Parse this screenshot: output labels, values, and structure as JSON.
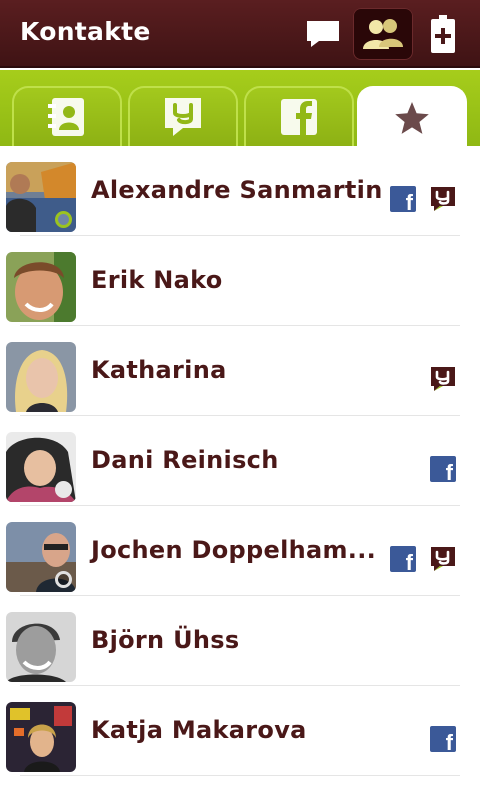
{
  "header": {
    "title": "Kontakte",
    "icons": [
      "message-icon",
      "contacts-icon",
      "battery-icon"
    ]
  },
  "tabs": [
    {
      "name": "address-book",
      "icon": "address-book-icon",
      "selected": false
    },
    {
      "name": "yap",
      "icon": "yap-icon",
      "selected": false
    },
    {
      "name": "facebook",
      "icon": "facebook-icon",
      "selected": false
    },
    {
      "name": "favorites",
      "icon": "star-icon",
      "selected": true
    }
  ],
  "contacts": [
    {
      "name": "Alexandre Sanmartin",
      "status": "online",
      "badges": [
        "facebook",
        "yap"
      ]
    },
    {
      "name": "Erik Nako",
      "status": "none",
      "badges": []
    },
    {
      "name": "Katharina",
      "status": "none",
      "badges": [
        "yap"
      ]
    },
    {
      "name": "Dani Reinisch",
      "status": "away",
      "badges": [
        "facebook"
      ]
    },
    {
      "name": "Jochen Doppelham...",
      "status": "idle",
      "badges": [
        "facebook",
        "yap"
      ]
    },
    {
      "name": "Björn Ühss",
      "status": "none",
      "badges": []
    },
    {
      "name": "Katja Makarova",
      "status": "none",
      "badges": [
        "facebook"
      ]
    }
  ],
  "colors": {
    "header": "#4a1819",
    "accent_green": "#9bc31f",
    "name_text": "#4a1818",
    "facebook_blue": "#3b5998"
  }
}
